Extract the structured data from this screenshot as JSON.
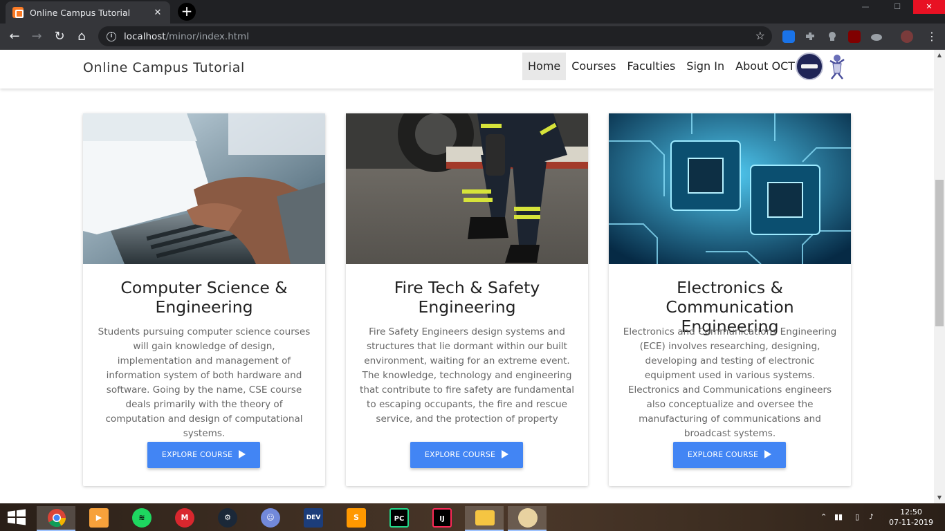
{
  "browser": {
    "tab_title": "Online Campus Tutorial",
    "tab_close": "✕",
    "new_tab": "+",
    "url_host": "localhost",
    "url_path": "/minor/index.html",
    "win_min": "—",
    "win_max": "☐",
    "win_close": "✕",
    "back": "←",
    "forward": "→",
    "reload": "↻",
    "home": "⌂",
    "star": "☆",
    "info": "i"
  },
  "site": {
    "brand": "Online Campus Tutorial",
    "nav": [
      "Home",
      "Courses",
      "Faculties",
      "Sign In",
      "About OCT"
    ],
    "active_nav": "Home"
  },
  "courses": [
    {
      "title_line1": "Computer Science &",
      "title_line2": "Engineering",
      "description": "Students pursuing computer science courses will gain knowledge of design, implementation and management of information system of both hardware and software. Going by the name, CSE course deals primarily with the theory of computation and design of computational systems.",
      "button": "EXPLORE COURSE",
      "image_icon": "laptop-typing-photo"
    },
    {
      "title_line1": "Fire Tech & Safety",
      "title_line2": "Engineering",
      "description": "Fire Safety Engineers design systems and structures that lie dormant within our built environment, waiting for an extreme event. The knowledge, technology and engineering that contribute to fire safety are fundamental to escaping occupants, the fire and rescue service, and the protection of property",
      "button": "EXPLORE COURSE",
      "image_icon": "firefighter-photo"
    },
    {
      "title_line1": "Electronics & Communication",
      "title_line2": "Engineering",
      "description": "Electronics and Communications Engineering (ECE) involves researching, designing, developing and testing of electronic equipment used in various systems. Electronics and Communications engineers also conceptualize and oversee the manufacturing of communications and broadcast systems.",
      "button": "EXPLORE COURSE",
      "image_icon": "circuit-chip-photo"
    }
  ],
  "taskbar": {
    "apps": [
      "chrome",
      "video-player",
      "spotify",
      "mega",
      "steam",
      "discord",
      "dev-cpp",
      "sublime-text",
      "pycharm",
      "intellij",
      "file-explorer",
      "paint"
    ],
    "icon_labels": {
      "mega": "M",
      "dev": "DEV",
      "sublime": "S",
      "pycharm": "PC",
      "intellij": "IJ"
    },
    "tray_caret": "⌃",
    "time": "12:50",
    "date": "07-11-2019"
  },
  "colors": {
    "accent": "#4285f4",
    "chrome_dark": "#202124",
    "chrome_toolbar": "#35363a",
    "active_nav_bg": "#e8e8e8"
  }
}
